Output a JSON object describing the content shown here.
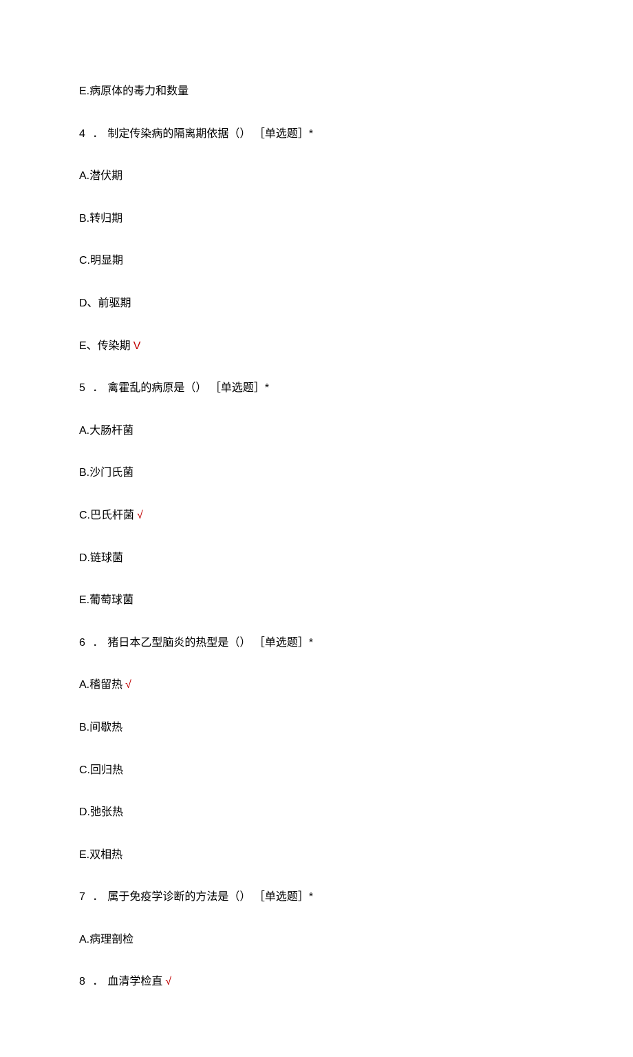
{
  "prev_q3_option_e": "E.病原体的毒力和数量",
  "questions": [
    {
      "num": "4",
      "sep": "．",
      "text": "制定传染病的隔离期依据（）",
      "tag": "［单选题］*",
      "options": [
        {
          "label": "A.潜伏期",
          "correct": false
        },
        {
          "label": "B.转归期",
          "correct": false
        },
        {
          "label": "C.明显期",
          "correct": false
        },
        {
          "label": "D、前驱期",
          "correct": false
        },
        {
          "label": "E、传染期",
          "correct": true,
          "mark": "V"
        }
      ]
    },
    {
      "num": "5",
      "sep": "．",
      "text": "禽霍乱的病原是（）",
      "tag": "［单选题］*",
      "options": [
        {
          "label": "A.大肠杆菌",
          "correct": false
        },
        {
          "label": "B.沙门氏菌",
          "correct": false
        },
        {
          "label": "C.巴氏杆菌",
          "correct": true,
          "mark": "√"
        },
        {
          "label": "D.链球菌",
          "correct": false
        },
        {
          "label": "E.葡萄球菌",
          "correct": false
        }
      ]
    },
    {
      "num": "6",
      "sep": "．",
      "text": "猪日本乙型脑炎的热型是（）",
      "tag": "［单选题］*",
      "options": [
        {
          "label": "A.稽留热",
          "correct": true,
          "mark": "√"
        },
        {
          "label": "B.间歇热",
          "correct": false
        },
        {
          "label": "C.回归热",
          "correct": false
        },
        {
          "label": "D.弛张热",
          "correct": false
        },
        {
          "label": "E.双相热",
          "correct": false
        }
      ]
    },
    {
      "num": "7",
      "sep": "．",
      "text": "属于免疫学诊断的方法是（）",
      "tag": "［单选题］*",
      "options": [
        {
          "label": "A.病理剖检",
          "correct": false
        }
      ]
    }
  ],
  "trailing_q8": {
    "num": "8",
    "sep": "．",
    "main": "血清学检直",
    "mark": "√"
  }
}
